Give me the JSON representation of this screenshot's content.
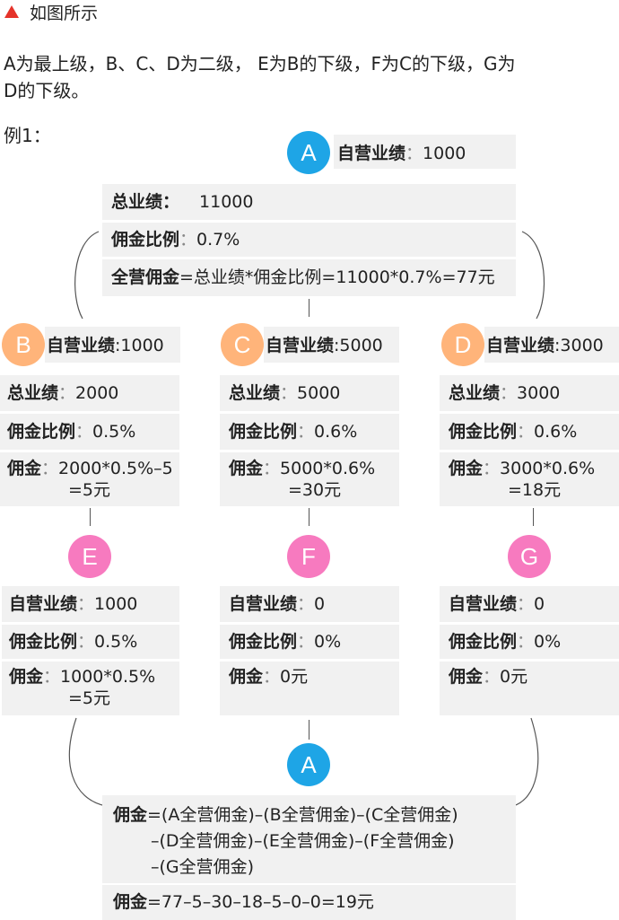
{
  "header": {
    "title": "如图所示",
    "accent": "#e5332a"
  },
  "intro": {
    "line1": "A为最上级，B、C、D为二级， E为B的下级，F为C的下级，G为",
    "line2": "D的下级。"
  },
  "example_label": "例1：",
  "top": {
    "node": "A",
    "self_label": "自营业绩",
    "self_value": "1000",
    "total_label": "总业绩：",
    "total_value": "11000",
    "ratio_label": "佣金比例",
    "ratio_value": "0.7%",
    "formula_label": "全营佣金",
    "formula_value": "=总业绩*佣金比例=11000*0.7%=77元"
  },
  "level2": [
    {
      "node": "B",
      "self_label": "自营业绩",
      "self_value": ":1000",
      "total_label": "总业绩",
      "total_value": "2000",
      "ratio_label": "佣金比例",
      "ratio_value": "0.5%",
      "comm_label": "佣金",
      "comm_line1": "2000*0.5%–5",
      "comm_line2": "=5元"
    },
    {
      "node": "C",
      "self_label": "自营业绩",
      "self_value": ":5000",
      "total_label": "总业绩",
      "total_value": "5000",
      "ratio_label": "佣金比例",
      "ratio_value": "0.6%",
      "comm_label": "佣金",
      "comm_line1": "5000*0.6%",
      "comm_line2": "=30元"
    },
    {
      "node": "D",
      "self_label": "自营业绩",
      "self_value": ":3000",
      "total_label": "总业绩",
      "total_value": "3000",
      "ratio_label": "佣金比例",
      "ratio_value": "0.6%",
      "comm_label": "佣金",
      "comm_line1": "3000*0.6%",
      "comm_line2": "=18元"
    }
  ],
  "level3": [
    {
      "node": "E",
      "self_label": "自营业绩",
      "self_value": "1000",
      "ratio_label": "佣金比例",
      "ratio_value": "0.5%",
      "comm_label": "佣金",
      "comm_line1": "1000*0.5%",
      "comm_line2": "=5元"
    },
    {
      "node": "F",
      "self_label": "自营业绩",
      "self_value": "0",
      "ratio_label": "佣金比例",
      "ratio_value": "0%",
      "comm_label": "佣金",
      "comm_line1": "0元",
      "comm_line2": ""
    },
    {
      "node": "G",
      "self_label": "自营业绩",
      "self_value": "0",
      "ratio_label": "佣金比例",
      "ratio_value": "0%",
      "comm_label": "佣金",
      "comm_line1": "0元",
      "comm_line2": ""
    }
  ],
  "bottom": {
    "node": "A",
    "formula_label": "佣金",
    "formula_line1": "=(A全营佣金)–(B全营佣金)–(C全营佣金)",
    "formula_line2": "–(D全营佣金)–(E全营佣金)–(F全营佣金)",
    "formula_line3": "–(G全营佣金)",
    "result_label": "佣金",
    "result_value": "=77–5–30–18–5–0–0=19元"
  },
  "colors": {
    "blue": "#1ea5e6",
    "orange": "#ffb47a",
    "pink": "#f77abf",
    "panel": "#f1f1f1"
  },
  "separator": "："
}
